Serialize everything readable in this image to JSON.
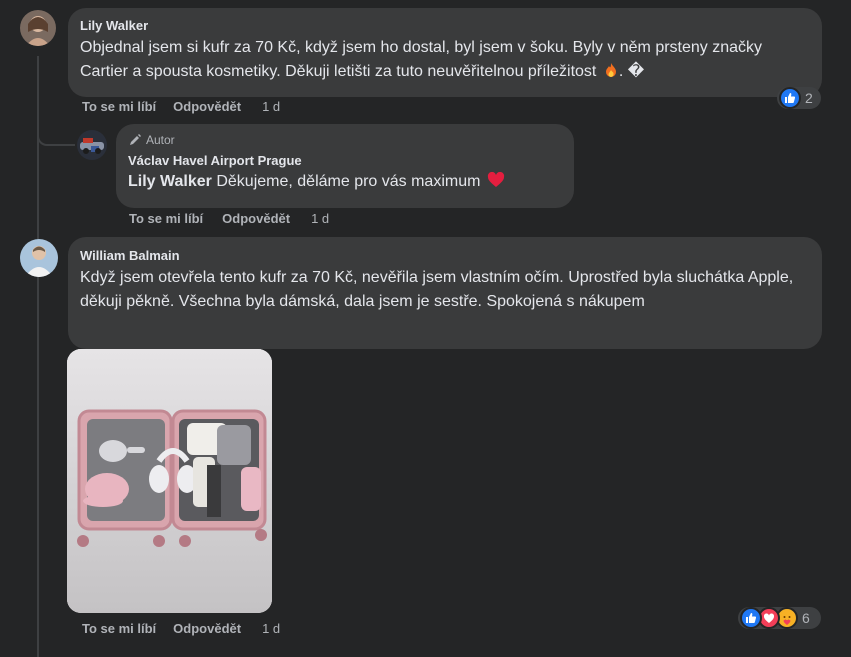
{
  "comments": [
    {
      "author": "Lily Walker",
      "text": "Objednal jsem si kufr za 70 Kč, když jsem ho dostal, byl jsem v šoku. Byly v něm prsteny značky Cartier a spousta kosmetiky. Děkuji letišti za tuto neuvěřitelnou příležitost",
      "text_tail": ". �",
      "actions": {
        "like": "To se mi líbí",
        "reply": "Odpovědět",
        "time": "1 d"
      },
      "reactions": {
        "icons": [
          "like-icon"
        ],
        "count": "2"
      }
    },
    {
      "badge": "Autor",
      "author": "Václav Havel Airport Prague",
      "mention": "Lily Walker",
      "text": "Děkujeme, děláme pro vás maximum",
      "actions": {
        "like": "To se mi líbí",
        "reply": "Odpovědět",
        "time": "1 d"
      }
    },
    {
      "author": "William Balmain",
      "text": "Když jsem otevřela tento kufr za 70 Kč, nevěřila jsem vlastním očím. Uprostřed byla sluchátka Apple, děkuji pěkně. Všechna byla dámská, dala jsem je sestře. Spokojená s nákupem",
      "actions": {
        "like": "To se mi líbí",
        "reply": "Odpovědět",
        "time": "1 d"
      },
      "reactions": {
        "icons": [
          "like-icon",
          "love-icon",
          "care-icon"
        ],
        "count": "6"
      }
    }
  ],
  "colors": {
    "like": "#2078f4",
    "love": "#f33e58",
    "care": "#f7b125",
    "heart": "#e41e3f",
    "fire": "#f26f1f"
  }
}
